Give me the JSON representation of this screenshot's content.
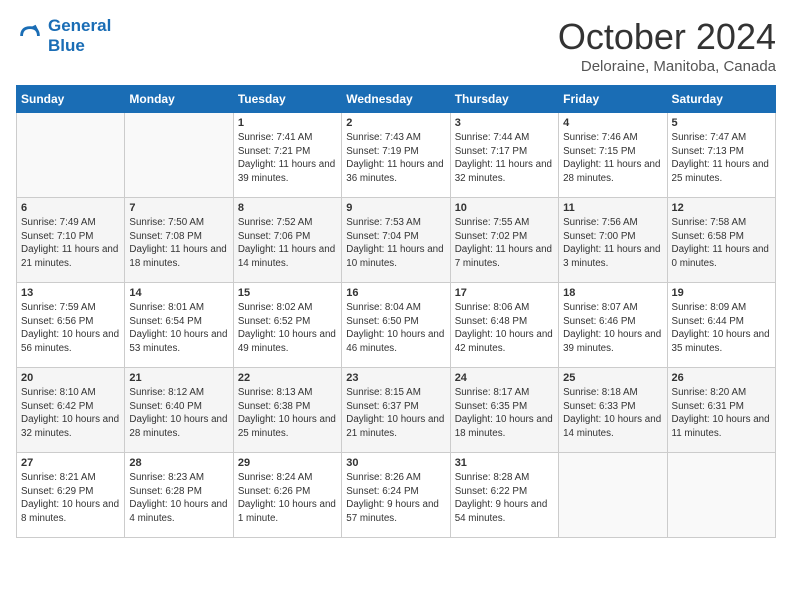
{
  "header": {
    "logo_line1": "General",
    "logo_line2": "Blue",
    "month": "October 2024",
    "location": "Deloraine, Manitoba, Canada"
  },
  "weekdays": [
    "Sunday",
    "Monday",
    "Tuesday",
    "Wednesday",
    "Thursday",
    "Friday",
    "Saturday"
  ],
  "weeks": [
    [
      {
        "day": "",
        "sunrise": "",
        "sunset": "",
        "daylight": ""
      },
      {
        "day": "",
        "sunrise": "",
        "sunset": "",
        "daylight": ""
      },
      {
        "day": "1",
        "sunrise": "Sunrise: 7:41 AM",
        "sunset": "Sunset: 7:21 PM",
        "daylight": "Daylight: 11 hours and 39 minutes."
      },
      {
        "day": "2",
        "sunrise": "Sunrise: 7:43 AM",
        "sunset": "Sunset: 7:19 PM",
        "daylight": "Daylight: 11 hours and 36 minutes."
      },
      {
        "day": "3",
        "sunrise": "Sunrise: 7:44 AM",
        "sunset": "Sunset: 7:17 PM",
        "daylight": "Daylight: 11 hours and 32 minutes."
      },
      {
        "day": "4",
        "sunrise": "Sunrise: 7:46 AM",
        "sunset": "Sunset: 7:15 PM",
        "daylight": "Daylight: 11 hours and 28 minutes."
      },
      {
        "day": "5",
        "sunrise": "Sunrise: 7:47 AM",
        "sunset": "Sunset: 7:13 PM",
        "daylight": "Daylight: 11 hours and 25 minutes."
      }
    ],
    [
      {
        "day": "6",
        "sunrise": "Sunrise: 7:49 AM",
        "sunset": "Sunset: 7:10 PM",
        "daylight": "Daylight: 11 hours and 21 minutes."
      },
      {
        "day": "7",
        "sunrise": "Sunrise: 7:50 AM",
        "sunset": "Sunset: 7:08 PM",
        "daylight": "Daylight: 11 hours and 18 minutes."
      },
      {
        "day": "8",
        "sunrise": "Sunrise: 7:52 AM",
        "sunset": "Sunset: 7:06 PM",
        "daylight": "Daylight: 11 hours and 14 minutes."
      },
      {
        "day": "9",
        "sunrise": "Sunrise: 7:53 AM",
        "sunset": "Sunset: 7:04 PM",
        "daylight": "Daylight: 11 hours and 10 minutes."
      },
      {
        "day": "10",
        "sunrise": "Sunrise: 7:55 AM",
        "sunset": "Sunset: 7:02 PM",
        "daylight": "Daylight: 11 hours and 7 minutes."
      },
      {
        "day": "11",
        "sunrise": "Sunrise: 7:56 AM",
        "sunset": "Sunset: 7:00 PM",
        "daylight": "Daylight: 11 hours and 3 minutes."
      },
      {
        "day": "12",
        "sunrise": "Sunrise: 7:58 AM",
        "sunset": "Sunset: 6:58 PM",
        "daylight": "Daylight: 11 hours and 0 minutes."
      }
    ],
    [
      {
        "day": "13",
        "sunrise": "Sunrise: 7:59 AM",
        "sunset": "Sunset: 6:56 PM",
        "daylight": "Daylight: 10 hours and 56 minutes."
      },
      {
        "day": "14",
        "sunrise": "Sunrise: 8:01 AM",
        "sunset": "Sunset: 6:54 PM",
        "daylight": "Daylight: 10 hours and 53 minutes."
      },
      {
        "day": "15",
        "sunrise": "Sunrise: 8:02 AM",
        "sunset": "Sunset: 6:52 PM",
        "daylight": "Daylight: 10 hours and 49 minutes."
      },
      {
        "day": "16",
        "sunrise": "Sunrise: 8:04 AM",
        "sunset": "Sunset: 6:50 PM",
        "daylight": "Daylight: 10 hours and 46 minutes."
      },
      {
        "day": "17",
        "sunrise": "Sunrise: 8:06 AM",
        "sunset": "Sunset: 6:48 PM",
        "daylight": "Daylight: 10 hours and 42 minutes."
      },
      {
        "day": "18",
        "sunrise": "Sunrise: 8:07 AM",
        "sunset": "Sunset: 6:46 PM",
        "daylight": "Daylight: 10 hours and 39 minutes."
      },
      {
        "day": "19",
        "sunrise": "Sunrise: 8:09 AM",
        "sunset": "Sunset: 6:44 PM",
        "daylight": "Daylight: 10 hours and 35 minutes."
      }
    ],
    [
      {
        "day": "20",
        "sunrise": "Sunrise: 8:10 AM",
        "sunset": "Sunset: 6:42 PM",
        "daylight": "Daylight: 10 hours and 32 minutes."
      },
      {
        "day": "21",
        "sunrise": "Sunrise: 8:12 AM",
        "sunset": "Sunset: 6:40 PM",
        "daylight": "Daylight: 10 hours and 28 minutes."
      },
      {
        "day": "22",
        "sunrise": "Sunrise: 8:13 AM",
        "sunset": "Sunset: 6:38 PM",
        "daylight": "Daylight: 10 hours and 25 minutes."
      },
      {
        "day": "23",
        "sunrise": "Sunrise: 8:15 AM",
        "sunset": "Sunset: 6:37 PM",
        "daylight": "Daylight: 10 hours and 21 minutes."
      },
      {
        "day": "24",
        "sunrise": "Sunrise: 8:17 AM",
        "sunset": "Sunset: 6:35 PM",
        "daylight": "Daylight: 10 hours and 18 minutes."
      },
      {
        "day": "25",
        "sunrise": "Sunrise: 8:18 AM",
        "sunset": "Sunset: 6:33 PM",
        "daylight": "Daylight: 10 hours and 14 minutes."
      },
      {
        "day": "26",
        "sunrise": "Sunrise: 8:20 AM",
        "sunset": "Sunset: 6:31 PM",
        "daylight": "Daylight: 10 hours and 11 minutes."
      }
    ],
    [
      {
        "day": "27",
        "sunrise": "Sunrise: 8:21 AM",
        "sunset": "Sunset: 6:29 PM",
        "daylight": "Daylight: 10 hours and 8 minutes."
      },
      {
        "day": "28",
        "sunrise": "Sunrise: 8:23 AM",
        "sunset": "Sunset: 6:28 PM",
        "daylight": "Daylight: 10 hours and 4 minutes."
      },
      {
        "day": "29",
        "sunrise": "Sunrise: 8:24 AM",
        "sunset": "Sunset: 6:26 PM",
        "daylight": "Daylight: 10 hours and 1 minute."
      },
      {
        "day": "30",
        "sunrise": "Sunrise: 8:26 AM",
        "sunset": "Sunset: 6:24 PM",
        "daylight": "Daylight: 9 hours and 57 minutes."
      },
      {
        "day": "31",
        "sunrise": "Sunrise: 8:28 AM",
        "sunset": "Sunset: 6:22 PM",
        "daylight": "Daylight: 9 hours and 54 minutes."
      },
      {
        "day": "",
        "sunrise": "",
        "sunset": "",
        "daylight": ""
      },
      {
        "day": "",
        "sunrise": "",
        "sunset": "",
        "daylight": ""
      }
    ]
  ]
}
